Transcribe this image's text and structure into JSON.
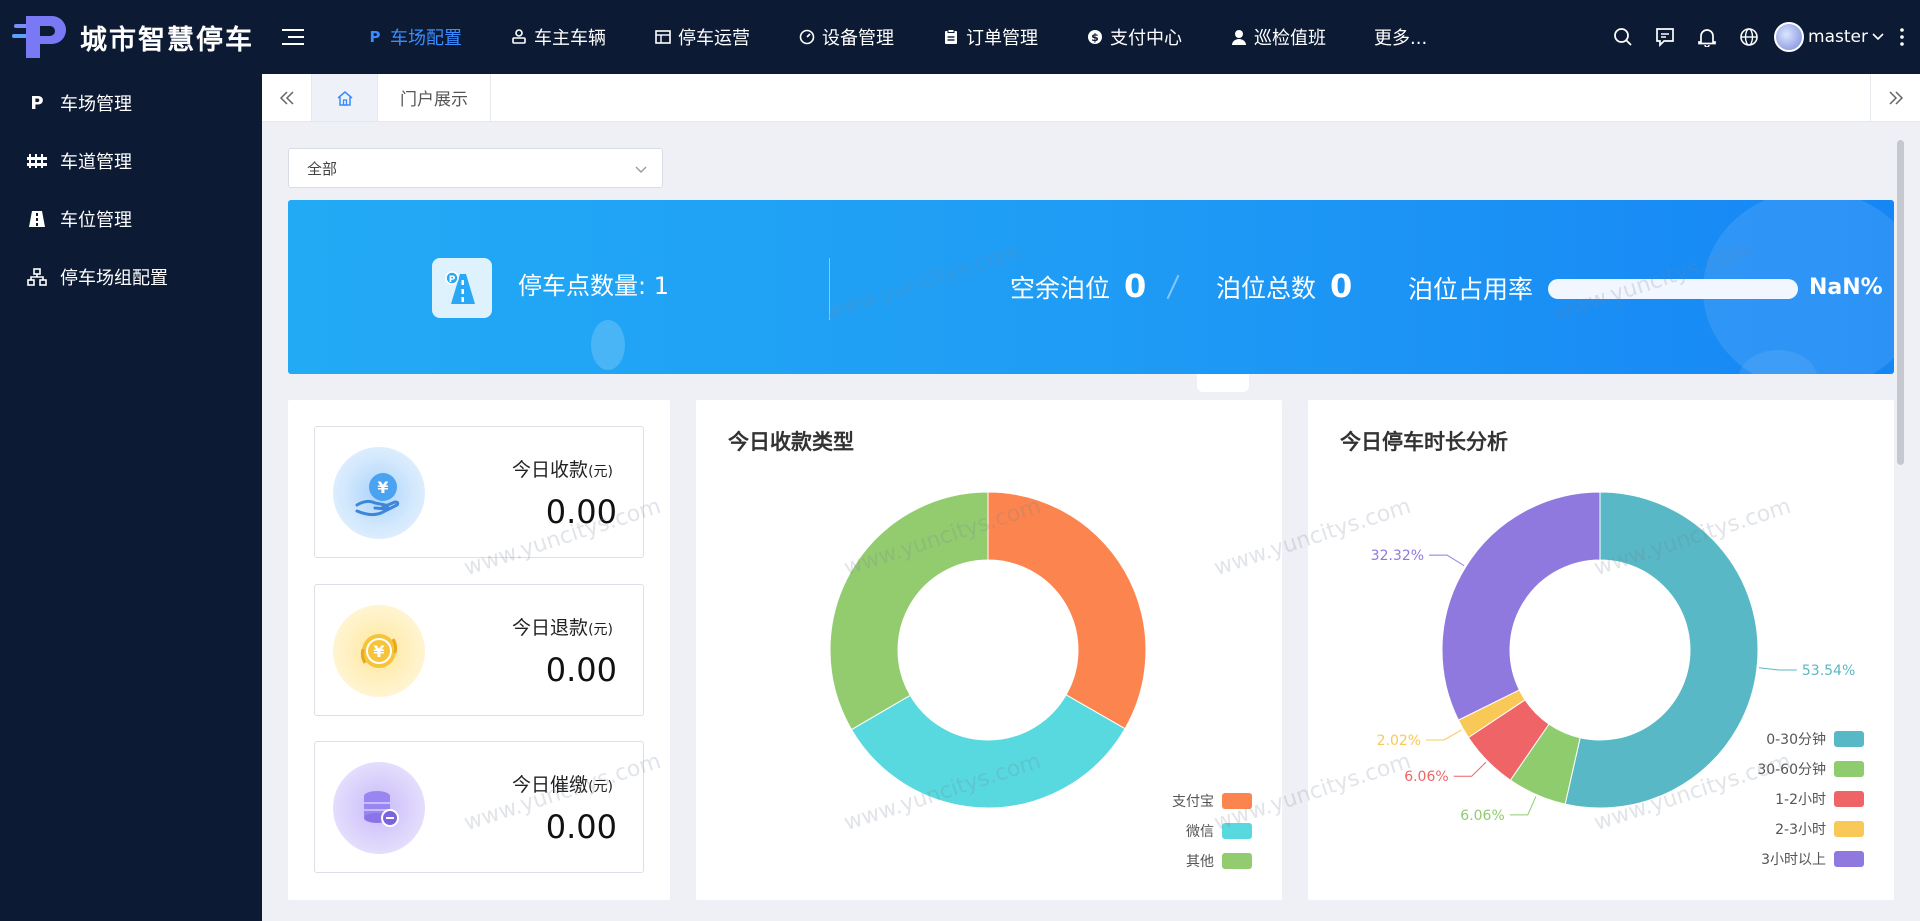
{
  "app": {
    "title": "城市智慧停车"
  },
  "topnav": {
    "items": [
      {
        "label": "车场配置",
        "icon": "parking-p-icon",
        "active": true
      },
      {
        "label": "车主车辆",
        "icon": "car-owner-icon"
      },
      {
        "label": "停车运营",
        "icon": "table-icon"
      },
      {
        "label": "设备管理",
        "icon": "gauge-icon"
      },
      {
        "label": "订单管理",
        "icon": "clipboard-icon"
      },
      {
        "label": "支付中心",
        "icon": "dollar-coin-icon"
      },
      {
        "label": "巡检值班",
        "icon": "user-icon"
      },
      {
        "label": "更多..."
      }
    ],
    "username": "master"
  },
  "sidebar": {
    "items": [
      {
        "label": "车场管理",
        "icon": "parking-p-icon"
      },
      {
        "label": "车道管理",
        "icon": "barrier-icon"
      },
      {
        "label": "车位管理",
        "icon": "road-icon"
      },
      {
        "label": "停车场组配置",
        "icon": "org-chart-icon"
      }
    ]
  },
  "tabs": {
    "items": [
      {
        "label": "门户展示"
      }
    ]
  },
  "filter": {
    "selected": "全部"
  },
  "banner": {
    "parking_count_label": "停车点数量: 1",
    "vacant_label": "空余泊位",
    "vacant_value": "0",
    "total_label": "泊位总数",
    "total_value": "0",
    "occupancy_label": "泊位占用率",
    "occupancy_value": "NaN%",
    "occupancy_fraction": 0
  },
  "money": [
    {
      "title": "今日收款",
      "unit": "(元)",
      "value": "0.00",
      "icon": "yen-hand-icon",
      "color": "#4aa3f0"
    },
    {
      "title": "今日退款",
      "unit": "(元)",
      "value": "0.00",
      "icon": "yen-refund-icon",
      "color": "#f5c43a"
    },
    {
      "title": "今日催缴",
      "unit": "(元)",
      "value": "0.00",
      "icon": "coin-stack-icon",
      "color": "#9a86f0"
    }
  ],
  "watermark": "www.yuncitys.com",
  "chart_data": [
    {
      "type": "pie",
      "title": "今日收款类型",
      "donut": true,
      "categories": [
        "支付宝",
        "微信",
        "其他"
      ],
      "values": [
        33.3,
        33.3,
        33.4
      ],
      "colors": [
        "#fc844e",
        "#58d9df",
        "#93cc6f"
      ],
      "legend": "bottom-right"
    },
    {
      "type": "pie",
      "title": "今日停车时长分析",
      "donut": true,
      "categories": [
        "0-30分钟",
        "30-60分钟",
        "1-2小时",
        "2-3小时",
        "3小时以上"
      ],
      "values": [
        53.54,
        6.06,
        6.06,
        2.02,
        32.32
      ],
      "labels": [
        "53.54%",
        "6.06%",
        "6.06%",
        "2.02%",
        "32.32%"
      ],
      "colors": [
        "#58b8c5",
        "#8fcc6e",
        "#ef6567",
        "#f9c957",
        "#9079de"
      ],
      "legend": "bottom-right"
    }
  ]
}
